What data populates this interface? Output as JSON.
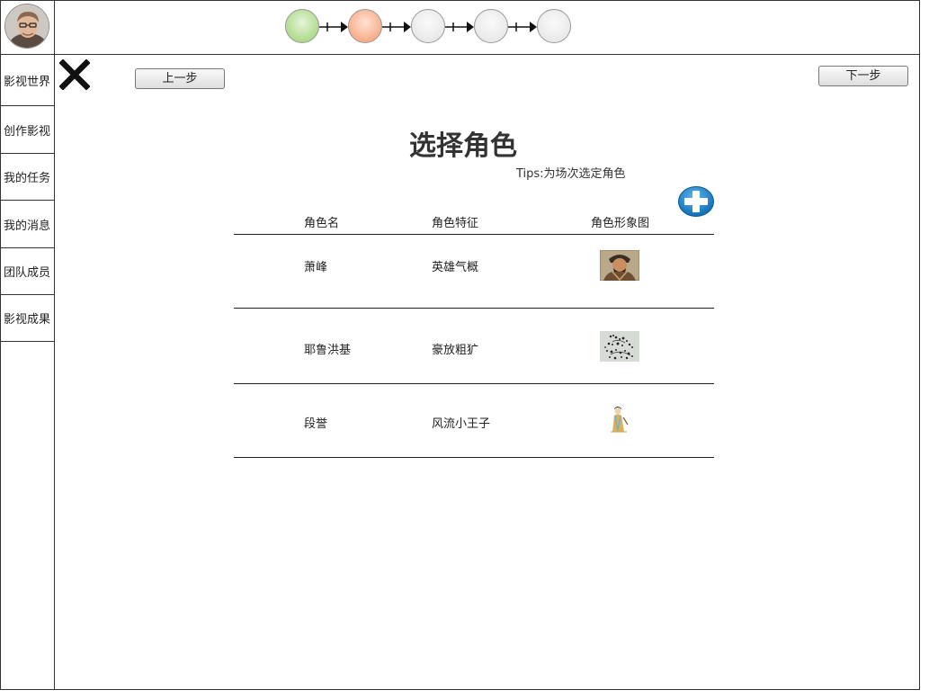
{
  "sidebar": {
    "items": [
      {
        "label": "影视世界"
      },
      {
        "label": "创作影视"
      },
      {
        "label": "我的任务"
      },
      {
        "label": "我的消息"
      },
      {
        "label": "团队成员"
      },
      {
        "label": "影视成果"
      }
    ]
  },
  "stepper": {
    "total_steps": 5,
    "completed_steps": 1,
    "current_step": 2
  },
  "nav": {
    "prev_label": "上一步",
    "next_label": "下一步"
  },
  "main": {
    "title": "选择角色",
    "tips": "Tips:为场次选定角色",
    "table": {
      "headers": [
        "角色名",
        "角色特征",
        "角色形象图"
      ],
      "rows": [
        {
          "name": "萧峰",
          "trait": "英雄气概",
          "image": "xiao-feng-portrait"
        },
        {
          "name": "耶鲁洪基",
          "trait": "豪放粗犷",
          "image": "yelu-hongji-sketch"
        },
        {
          "name": "段誉",
          "trait": "风流小王子",
          "image": "duan-yu-figure"
        }
      ]
    }
  },
  "colors": {
    "step_done": "#98cf6c",
    "step_active": "#f4976a",
    "step_todo": "#e2e2e2",
    "add_button": "#1a7fc7"
  },
  "icons": {
    "close": "close-x-icon",
    "add": "plus-circle-icon",
    "avatar": "user-avatar"
  }
}
